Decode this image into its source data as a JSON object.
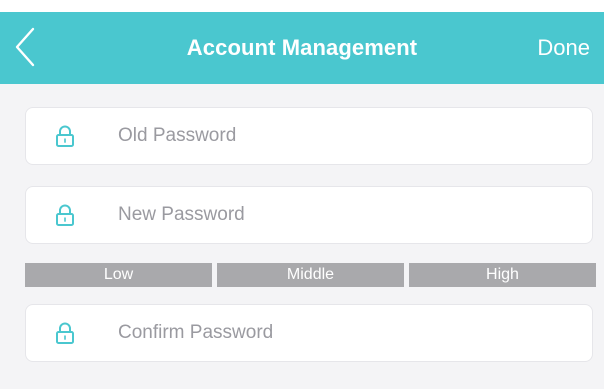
{
  "header": {
    "title": "Account Management",
    "done_label": "Done",
    "back_icon": "chevron-left-icon",
    "color": "#4ac7cf"
  },
  "form": {
    "old_password": {
      "placeholder": "Old Password",
      "icon": "lock-icon"
    },
    "new_password": {
      "placeholder": "New Password",
      "icon": "lock-icon"
    },
    "confirm_password": {
      "placeholder": "Confirm Password",
      "icon": "lock-icon"
    }
  },
  "strength": {
    "levels": [
      "Low",
      "Middle",
      "High"
    ],
    "segment_color": "#a9a9ac"
  },
  "colors": {
    "accent": "#4ac7cf",
    "background": "#f4f4f6",
    "field_background": "#ffffff"
  }
}
